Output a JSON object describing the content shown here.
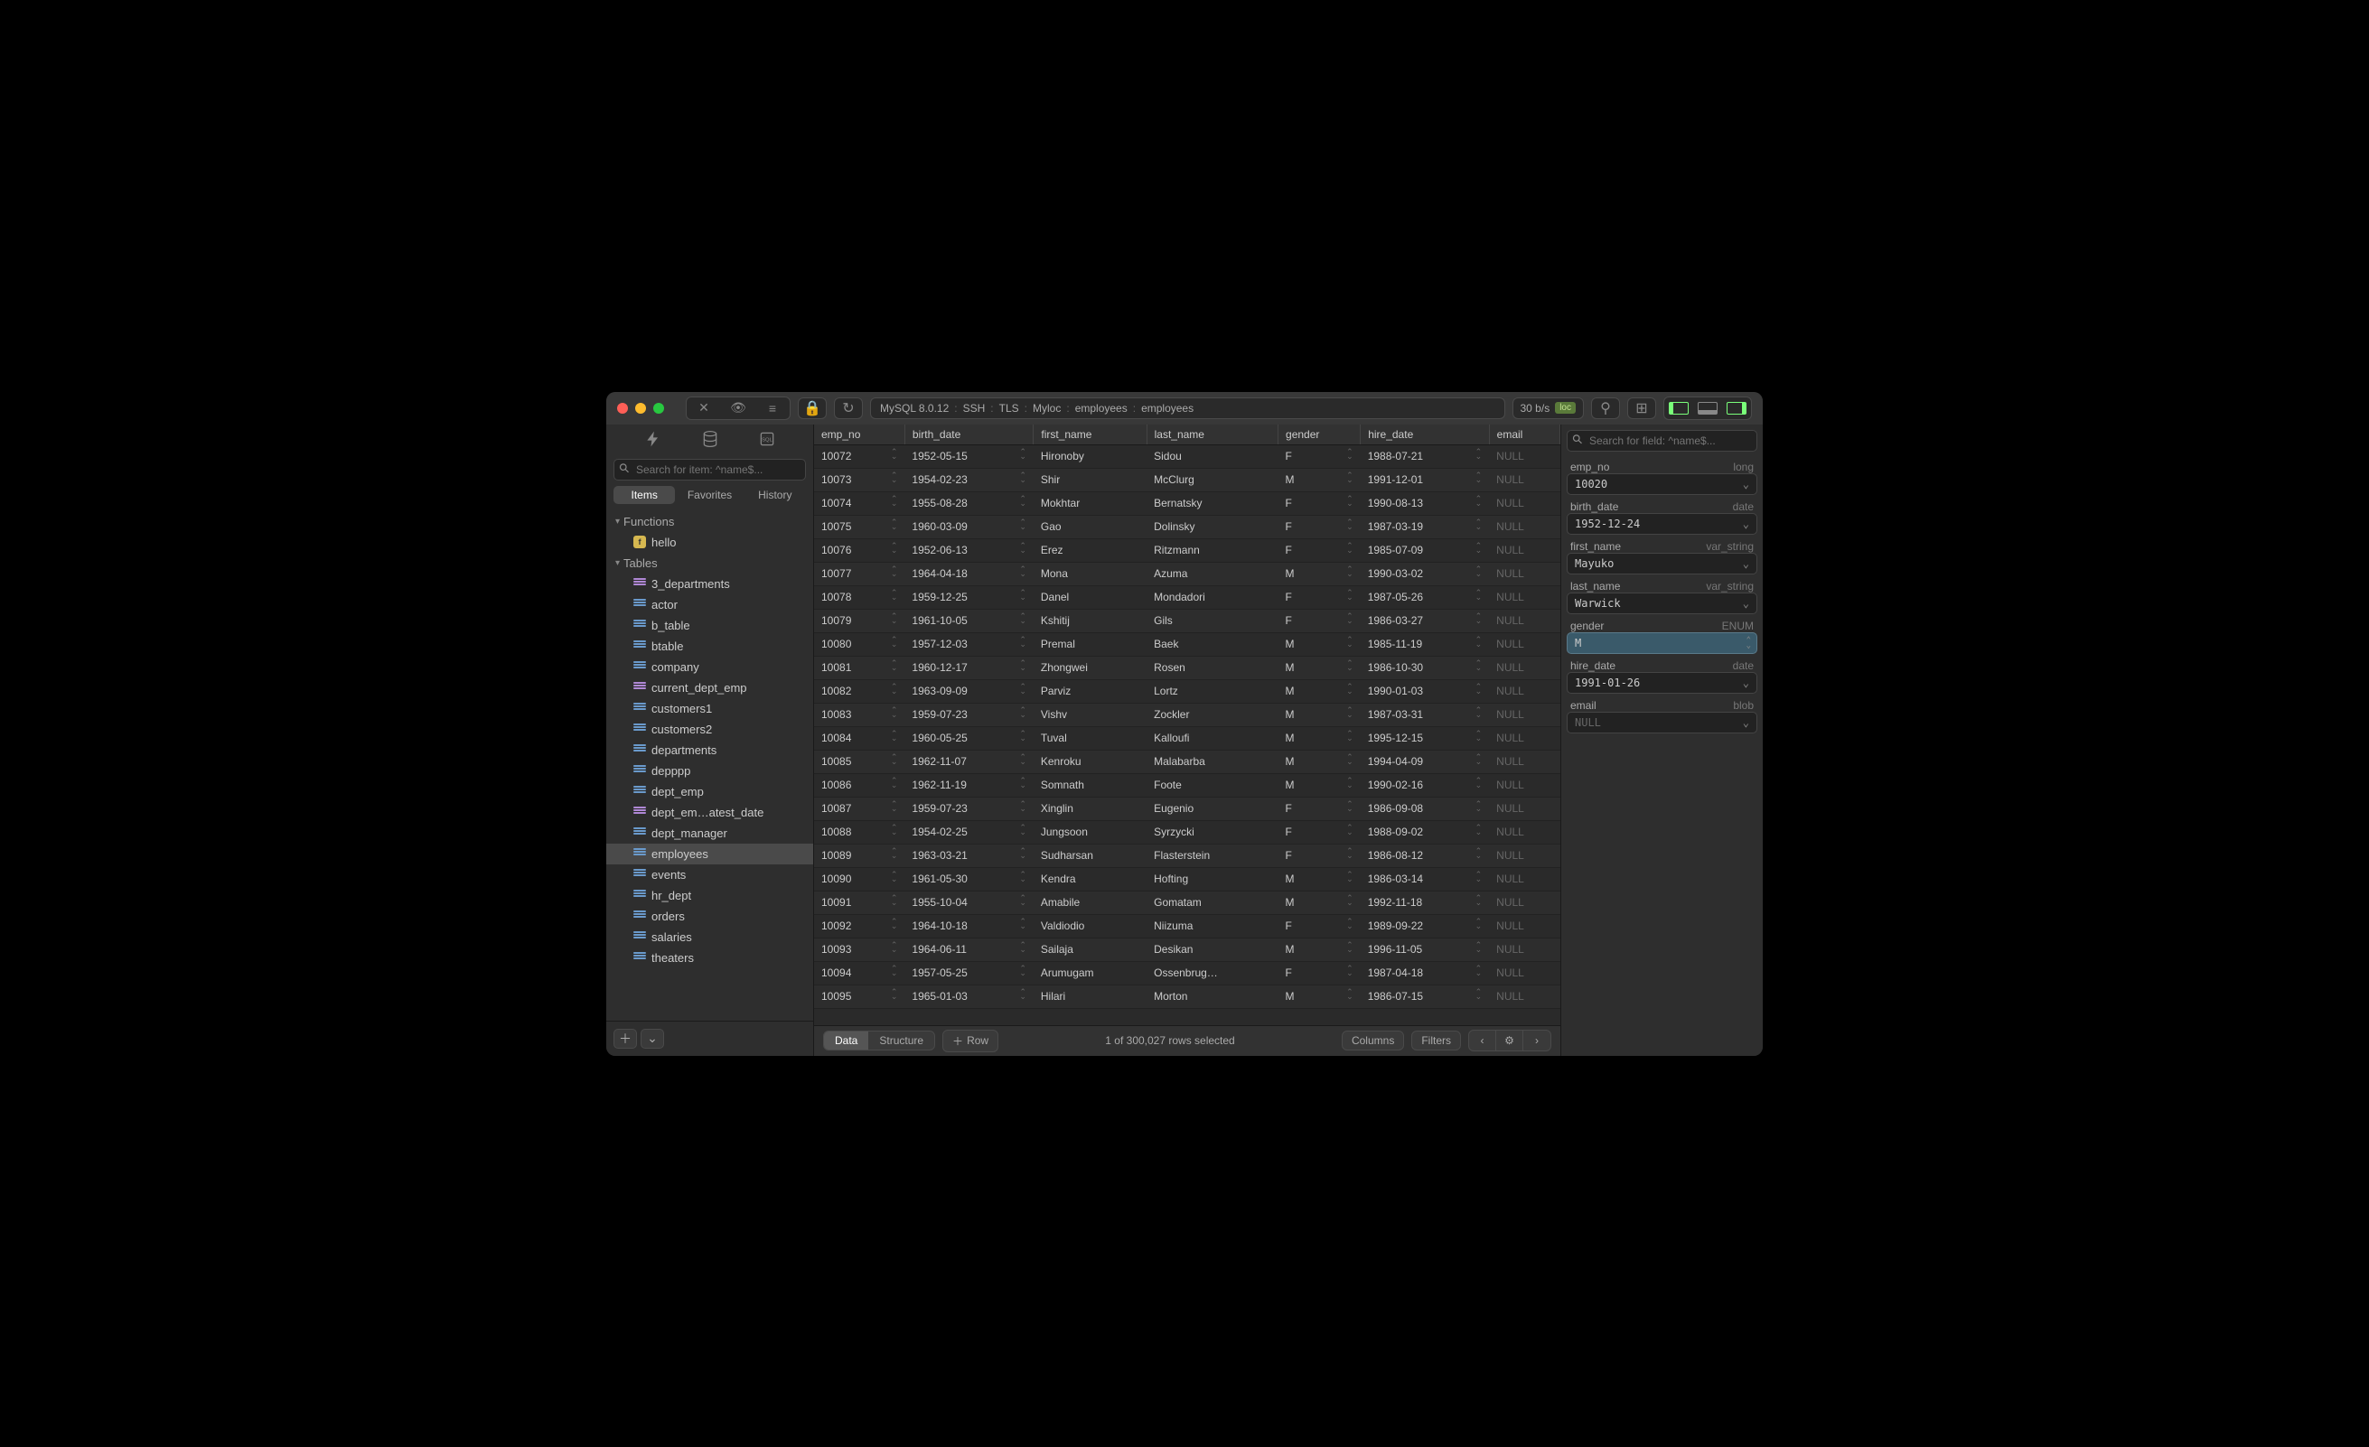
{
  "titlebar": {
    "breadcrumb": [
      "MySQL 8.0.12",
      "SSH",
      "TLS",
      "Myloc",
      "employees",
      "employees"
    ],
    "speed": "30 b/s",
    "loc_badge": "loc"
  },
  "sidebar": {
    "search_placeholder": "Search for item: ^name$...",
    "tabs": [
      "Items",
      "Favorites",
      "History"
    ],
    "active_tab": 0,
    "sections": [
      {
        "name": "Functions",
        "items": [
          {
            "label": "hello",
            "icon": "fn"
          }
        ]
      },
      {
        "name": "Tables",
        "items": [
          {
            "label": "3_departments",
            "icon": "purple"
          },
          {
            "label": "actor",
            "icon": "blue"
          },
          {
            "label": "b_table",
            "icon": "blue"
          },
          {
            "label": "btable",
            "icon": "blue"
          },
          {
            "label": "company",
            "icon": "blue"
          },
          {
            "label": "current_dept_emp",
            "icon": "purple"
          },
          {
            "label": "customers1",
            "icon": "blue"
          },
          {
            "label": "customers2",
            "icon": "blue"
          },
          {
            "label": "departments",
            "icon": "blue"
          },
          {
            "label": "depppp",
            "icon": "blue"
          },
          {
            "label": "dept_emp",
            "icon": "blue"
          },
          {
            "label": "dept_em…atest_date",
            "icon": "purple"
          },
          {
            "label": "dept_manager",
            "icon": "blue"
          },
          {
            "label": "employees",
            "icon": "blue",
            "selected": true
          },
          {
            "label": "events",
            "icon": "blue"
          },
          {
            "label": "hr_dept",
            "icon": "blue"
          },
          {
            "label": "orders",
            "icon": "blue"
          },
          {
            "label": "salaries",
            "icon": "blue"
          },
          {
            "label": "theaters",
            "icon": "blue"
          }
        ]
      }
    ]
  },
  "table": {
    "columns": [
      "emp_no",
      "birth_date",
      "first_name",
      "last_name",
      "gender",
      "hire_date",
      "email"
    ],
    "rows": [
      {
        "emp_no": "10072",
        "birth_date": "1952-05-15",
        "first_name": "Hironoby",
        "last_name": "Sidou",
        "gender": "F",
        "hire_date": "1988-07-21",
        "email": "NULL"
      },
      {
        "emp_no": "10073",
        "birth_date": "1954-02-23",
        "first_name": "Shir",
        "last_name": "McClurg",
        "gender": "M",
        "hire_date": "1991-12-01",
        "email": "NULL"
      },
      {
        "emp_no": "10074",
        "birth_date": "1955-08-28",
        "first_name": "Mokhtar",
        "last_name": "Bernatsky",
        "gender": "F",
        "hire_date": "1990-08-13",
        "email": "NULL"
      },
      {
        "emp_no": "10075",
        "birth_date": "1960-03-09",
        "first_name": "Gao",
        "last_name": "Dolinsky",
        "gender": "F",
        "hire_date": "1987-03-19",
        "email": "NULL"
      },
      {
        "emp_no": "10076",
        "birth_date": "1952-06-13",
        "first_name": "Erez",
        "last_name": "Ritzmann",
        "gender": "F",
        "hire_date": "1985-07-09",
        "email": "NULL"
      },
      {
        "emp_no": "10077",
        "birth_date": "1964-04-18",
        "first_name": "Mona",
        "last_name": "Azuma",
        "gender": "M",
        "hire_date": "1990-03-02",
        "email": "NULL"
      },
      {
        "emp_no": "10078",
        "birth_date": "1959-12-25",
        "first_name": "Danel",
        "last_name": "Mondadori",
        "gender": "F",
        "hire_date": "1987-05-26",
        "email": "NULL"
      },
      {
        "emp_no": "10079",
        "birth_date": "1961-10-05",
        "first_name": "Kshitij",
        "last_name": "Gils",
        "gender": "F",
        "hire_date": "1986-03-27",
        "email": "NULL"
      },
      {
        "emp_no": "10080",
        "birth_date": "1957-12-03",
        "first_name": "Premal",
        "last_name": "Baek",
        "gender": "M",
        "hire_date": "1985-11-19",
        "email": "NULL"
      },
      {
        "emp_no": "10081",
        "birth_date": "1960-12-17",
        "first_name": "Zhongwei",
        "last_name": "Rosen",
        "gender": "M",
        "hire_date": "1986-10-30",
        "email": "NULL"
      },
      {
        "emp_no": "10082",
        "birth_date": "1963-09-09",
        "first_name": "Parviz",
        "last_name": "Lortz",
        "gender": "M",
        "hire_date": "1990-01-03",
        "email": "NULL"
      },
      {
        "emp_no": "10083",
        "birth_date": "1959-07-23",
        "first_name": "Vishv",
        "last_name": "Zockler",
        "gender": "M",
        "hire_date": "1987-03-31",
        "email": "NULL"
      },
      {
        "emp_no": "10084",
        "birth_date": "1960-05-25",
        "first_name": "Tuval",
        "last_name": "Kalloufi",
        "gender": "M",
        "hire_date": "1995-12-15",
        "email": "NULL"
      },
      {
        "emp_no": "10085",
        "birth_date": "1962-11-07",
        "first_name": "Kenroku",
        "last_name": "Malabarba",
        "gender": "M",
        "hire_date": "1994-04-09",
        "email": "NULL"
      },
      {
        "emp_no": "10086",
        "birth_date": "1962-11-19",
        "first_name": "Somnath",
        "last_name": "Foote",
        "gender": "M",
        "hire_date": "1990-02-16",
        "email": "NULL"
      },
      {
        "emp_no": "10087",
        "birth_date": "1959-07-23",
        "first_name": "Xinglin",
        "last_name": "Eugenio",
        "gender": "F",
        "hire_date": "1986-09-08",
        "email": "NULL"
      },
      {
        "emp_no": "10088",
        "birth_date": "1954-02-25",
        "first_name": "Jungsoon",
        "last_name": "Syrzycki",
        "gender": "F",
        "hire_date": "1988-09-02",
        "email": "NULL"
      },
      {
        "emp_no": "10089",
        "birth_date": "1963-03-21",
        "first_name": "Sudharsan",
        "last_name": "Flasterstein",
        "gender": "F",
        "hire_date": "1986-08-12",
        "email": "NULL"
      },
      {
        "emp_no": "10090",
        "birth_date": "1961-05-30",
        "first_name": "Kendra",
        "last_name": "Hofting",
        "gender": "M",
        "hire_date": "1986-03-14",
        "email": "NULL"
      },
      {
        "emp_no": "10091",
        "birth_date": "1955-10-04",
        "first_name": "Amabile",
        "last_name": "Gomatam",
        "gender": "M",
        "hire_date": "1992-11-18",
        "email": "NULL"
      },
      {
        "emp_no": "10092",
        "birth_date": "1964-10-18",
        "first_name": "Valdiodio",
        "last_name": "Niizuma",
        "gender": "F",
        "hire_date": "1989-09-22",
        "email": "NULL"
      },
      {
        "emp_no": "10093",
        "birth_date": "1964-06-11",
        "first_name": "Sailaja",
        "last_name": "Desikan",
        "gender": "M",
        "hire_date": "1996-11-05",
        "email": "NULL"
      },
      {
        "emp_no": "10094",
        "birth_date": "1957-05-25",
        "first_name": "Arumugam",
        "last_name": "Ossenbrug…",
        "gender": "F",
        "hire_date": "1987-04-18",
        "email": "NULL"
      },
      {
        "emp_no": "10095",
        "birth_date": "1965-01-03",
        "first_name": "Hilari",
        "last_name": "Morton",
        "gender": "M",
        "hire_date": "1986-07-15",
        "email": "NULL"
      }
    ]
  },
  "footer": {
    "seg": [
      "Data",
      "Structure"
    ],
    "active_seg": 0,
    "row_btn": "Row",
    "status": "1 of 300,027 rows selected",
    "columns_btn": "Columns",
    "filters_btn": "Filters"
  },
  "inspector": {
    "search_placeholder": "Search for field: ^name$...",
    "fields": [
      {
        "name": "emp_no",
        "type": "long",
        "value": "10020"
      },
      {
        "name": "birth_date",
        "type": "date",
        "value": "1952-12-24"
      },
      {
        "name": "first_name",
        "type": "var_string",
        "value": "Mayuko"
      },
      {
        "name": "last_name",
        "type": "var_string",
        "value": "Warwick"
      },
      {
        "name": "gender",
        "type": "ENUM",
        "value": "M",
        "enum": true
      },
      {
        "name": "hire_date",
        "type": "date",
        "value": "1991-01-26"
      },
      {
        "name": "email",
        "type": "blob",
        "value": "NULL",
        "null": true
      }
    ]
  }
}
